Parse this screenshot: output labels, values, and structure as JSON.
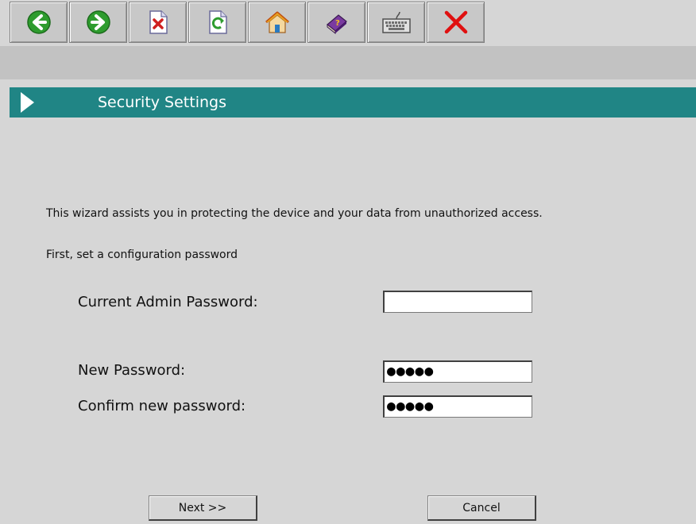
{
  "toolbar": {
    "buttons": [
      {
        "icon": "back-arrow-icon",
        "color": "#2e9c2e"
      },
      {
        "icon": "forward-arrow-icon",
        "color": "#2e9c2e"
      },
      {
        "icon": "close-document-icon",
        "color": "#d02020"
      },
      {
        "icon": "refresh-icon",
        "color": "#2e9c2e"
      },
      {
        "icon": "home-icon",
        "color": "#e8a020"
      },
      {
        "icon": "help-book-icon",
        "color": "#6a2a8a"
      },
      {
        "icon": "keyboard-icon",
        "color": "#606060"
      },
      {
        "icon": "exit-x-icon",
        "color": "#e01010"
      }
    ]
  },
  "header": {
    "title": "Security Settings",
    "accent_color": "#208585"
  },
  "main": {
    "intro": "This wizard assists you in protecting the device and your data from unauthorized access.",
    "subintro": "First, set a configuration password",
    "fields": {
      "current_admin_password": {
        "label": "Current Admin Password:",
        "value": ""
      },
      "new_password": {
        "label": "New Password:",
        "value": "●●●●●"
      },
      "confirm_password": {
        "label": "Confirm new password:",
        "value": "●●●●●"
      }
    }
  },
  "footer": {
    "next_label": "Next >>",
    "cancel_label": "Cancel"
  }
}
